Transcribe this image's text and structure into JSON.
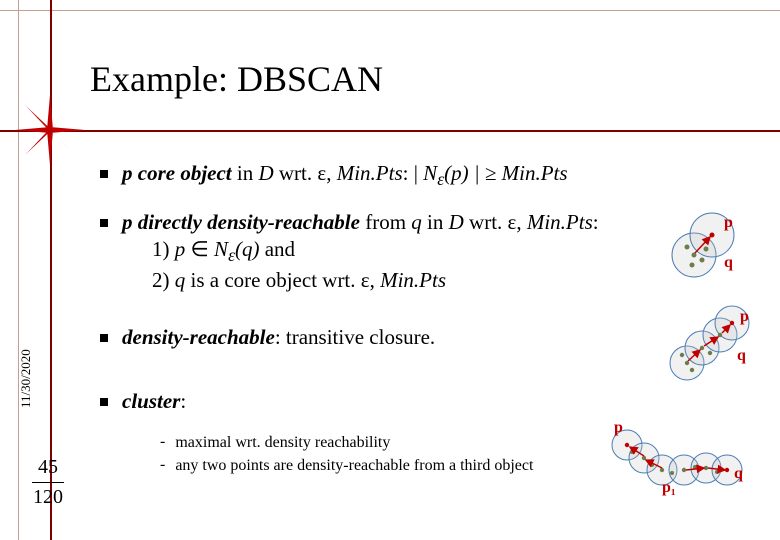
{
  "title": "Example: DBSCAN",
  "date": "11/30/2020",
  "page": {
    "current": "45",
    "total": "120"
  },
  "bullets": [
    {
      "lead": "p core object",
      "rest_pre": " in ",
      "d": "D",
      "rest_mid": " wrt. ε, ",
      "minpts1": "Min.Pts",
      "sep": ":  | ",
      "np": "N",
      "sub": "ε",
      "paren": "(p) | ≥ ",
      "minpts2": "Min.Pts"
    },
    {
      "lead": "p directly density-reachable",
      "rest1": " from ",
      "q": "q",
      "rest2": " in ",
      "d": "D",
      "rest3": " wrt. ε, ",
      "minpts": "Min.Pts",
      "colon": ":",
      "line1a": "1) ",
      "line1p": "p",
      "line1in": " ∈ ",
      "line1n": "N",
      "line1sub": "ε",
      "line1q": "(q)",
      "line1and": "  and",
      "line2a": "2) ",
      "line2q": "q",
      "line2rest": " is a core object wrt. ε, ",
      "line2minpts": "Min.Pts"
    },
    {
      "lead": "density-reachable",
      "rest": ": transitive closure."
    },
    {
      "lead": "cluster",
      "rest": ":",
      "subs": [
        "maximal wrt. density reachability",
        "any two points are density-reachable from a third object"
      ]
    }
  ],
  "fig": {
    "p": "p",
    "q": "q",
    "p1": "p₁"
  }
}
